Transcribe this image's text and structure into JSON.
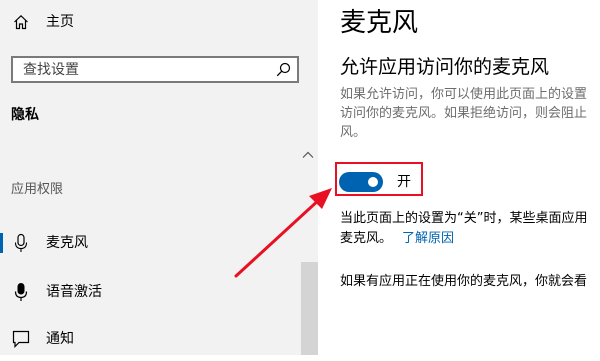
{
  "sidebar": {
    "home_label": "主页",
    "search_placeholder": "查找设置",
    "section_title": "隐私",
    "group_label": "应用权限",
    "items": [
      {
        "label": "麦克风",
        "icon": "microphone-outline-icon",
        "selected": true
      },
      {
        "label": "语音激活",
        "icon": "microphone-filled-icon",
        "selected": false
      },
      {
        "label": "通知",
        "icon": "notification-icon",
        "selected": false
      }
    ]
  },
  "main": {
    "title": "麦克风",
    "subtitle": "允许应用访问你的麦克风",
    "description_lines": [
      "如果允许访问，你可以使用此页面上的设置",
      "访问你的麦克风。如果拒绝访问，则会阻止",
      "风。"
    ],
    "toggle": {
      "state_label": "开",
      "on": true
    },
    "note_lines": [
      "当此页面上的设置为“关”时，某些桌面应用",
      "麦克风。"
    ],
    "learn_why_link": "了解原因",
    "bottom_note": "如果有应用正在使用你的麦克风，你就会看"
  },
  "colors": {
    "accent": "#0063b1",
    "highlight_frame": "#e81123",
    "annotation_arrow": "#e81123",
    "sidebar_bg": "#f2f2f2"
  }
}
